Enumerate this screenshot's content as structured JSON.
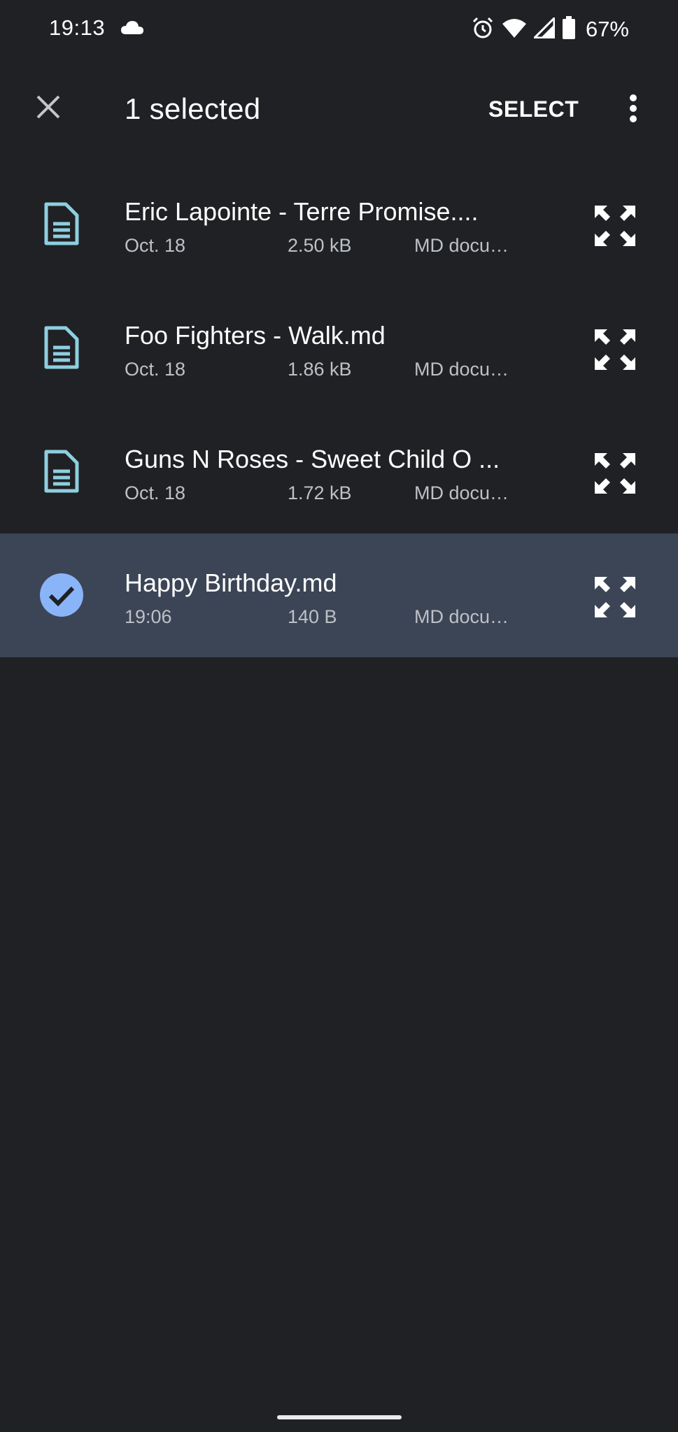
{
  "status_bar": {
    "time": "19:13",
    "battery_percent": "67%",
    "icons": [
      "cloud-icon",
      "alarm-icon",
      "wifi-icon",
      "signal-icon",
      "battery-icon"
    ]
  },
  "app_bar": {
    "title": "1 selected",
    "select_label": "SELECT",
    "icons": [
      "close-icon",
      "more-vert-icon"
    ]
  },
  "files": [
    {
      "name": "Eric Lapointe - Terre Promise....",
      "date": "Oct. 18",
      "size": "2.50 kB",
      "type": "MD docu…",
      "selected": false
    },
    {
      "name": "Foo Fighters - Walk.md",
      "date": "Oct. 18",
      "size": "1.86 kB",
      "type": "MD docu…",
      "selected": false
    },
    {
      "name": "Guns N Roses - Sweet Child O ...",
      "date": "Oct. 18",
      "size": "1.72 kB",
      "type": "MD docu…",
      "selected": false
    },
    {
      "name": "Happy Birthday.md",
      "date": "19:06",
      "size": "140 B",
      "type": "MD docu…",
      "selected": true
    }
  ],
  "colors": {
    "background": "#202124",
    "selected_row": "#3c4556",
    "doc_icon": "#8ecfe0",
    "check_circle": "#8ab4f8"
  }
}
